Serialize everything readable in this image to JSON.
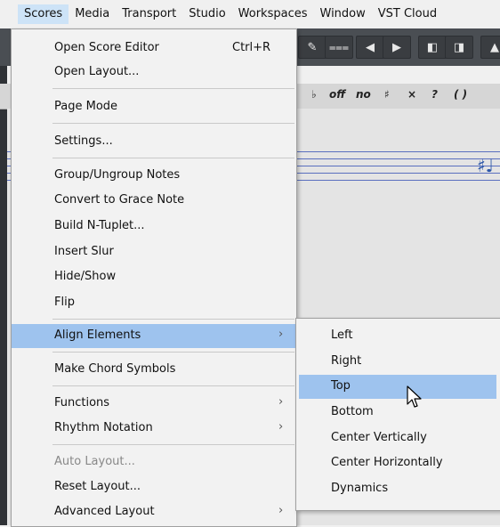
{
  "menubar": {
    "items": [
      "Scores",
      "Media",
      "Transport",
      "Studio",
      "Workspaces",
      "Window",
      "VST Cloud"
    ]
  },
  "toolbar": {
    "icons": [
      "pencil-icon",
      "tuplet-icon",
      "arrow-left-icon",
      "arrow-right-icon",
      "nav-left-icon",
      "nav-right-icon",
      "arrow-up-icon"
    ]
  },
  "symbolbar": {
    "symbols": [
      "♭",
      "off",
      "no",
      "♯",
      "×",
      "?",
      "( )"
    ]
  },
  "scores_menu": {
    "items": [
      {
        "label": "Open Score Editor",
        "shortcut": "Ctrl+R"
      },
      {
        "label": "Open Layout..."
      },
      {
        "label": "Page Mode"
      },
      {
        "label": "Settings..."
      },
      {
        "label": "Group/Ungroup Notes"
      },
      {
        "label": "Convert to Grace Note"
      },
      {
        "label": "Build N-Tuplet..."
      },
      {
        "label": "Insert Slur"
      },
      {
        "label": "Hide/Show"
      },
      {
        "label": "Flip"
      },
      {
        "label": "Align Elements",
        "submenu": true,
        "highlighted": true
      },
      {
        "label": "Make Chord Symbols"
      },
      {
        "label": "Functions",
        "submenu": true
      },
      {
        "label": "Rhythm Notation",
        "submenu": true
      },
      {
        "label": "Auto Layout...",
        "disabled": true
      },
      {
        "label": "Reset Layout..."
      },
      {
        "label": "Advanced Layout",
        "submenu": true
      }
    ]
  },
  "align_submenu": {
    "items": [
      {
        "label": "Left"
      },
      {
        "label": "Right"
      },
      {
        "label": "Top",
        "highlighted": true
      },
      {
        "label": "Bottom"
      },
      {
        "label": "Center Vertically"
      },
      {
        "label": "Center Horizontally"
      },
      {
        "label": "Dynamics"
      }
    ]
  },
  "colors": {
    "highlight": "#9ec3ee",
    "menubar_active": "#cde3f7",
    "toolbar": "#4a4e53",
    "staff_line": "#5a6fbf"
  }
}
